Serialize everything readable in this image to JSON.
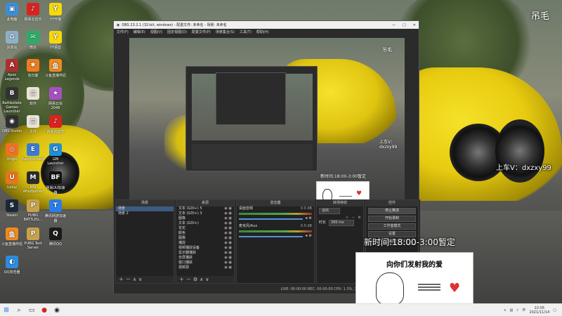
{
  "desktop": {
    "corner_text": "吊毛",
    "icons": [
      {
        "label": "此电脑",
        "icon": "computer-icon",
        "color": "#3b8edb",
        "glyph": "▣"
      },
      {
        "label": "网易云音乐",
        "icon": "netease-music-icon",
        "color": "#d8231f",
        "glyph": "♪"
      },
      {
        "label": "YY开播",
        "icon": "yy-icon",
        "color": "#f5d90a",
        "glyph": "Y"
      },
      {
        "label": "回收站",
        "icon": "recycle-bin-icon",
        "color": "#8fb0c8",
        "glyph": "♻"
      },
      {
        "label": "微信",
        "icon": "wechat-icon",
        "color": "#2aae67",
        "glyph": "✉"
      },
      {
        "label": "YY语音",
        "icon": "yy-voice-icon",
        "color": "#f5d90a",
        "glyph": "Y"
      },
      {
        "label": "Apex Legends",
        "icon": "apex-icon",
        "color": "#b22d2d",
        "glyph": "A"
      },
      {
        "label": "向日葵",
        "icon": "sunlogin-icon",
        "color": "#f07a1d",
        "glyph": "✱"
      },
      {
        "label": "斗鱼直播伴侣",
        "icon": "douyu-icon",
        "color": "#f28a1e",
        "glyph": "鱼"
      },
      {
        "label": "Battlestate Games Launcher",
        "icon": "bsg-icon",
        "color": "#333333",
        "glyph": "B"
      },
      {
        "label": "软件",
        "icon": "folder-icon",
        "color": "#e9e4d7",
        "glyph": "▤"
      },
      {
        "label": "网易云信 2048",
        "icon": "game-icon",
        "color": "#a94fc2",
        "glyph": "★"
      },
      {
        "label": "OBS Studio",
        "icon": "obs-icon",
        "color": "#302e31",
        "glyph": "◉"
      },
      {
        "label": "文件",
        "icon": "file-icon",
        "color": "#e9e4d7",
        "glyph": "▤"
      },
      {
        "label": "网易云音乐",
        "icon": "netease-music-icon-2",
        "color": "#d8231f",
        "glyph": "♪"
      },
      {
        "label": "Origin",
        "icon": "origin-icon",
        "color": "#f26f21",
        "glyph": "◎"
      },
      {
        "label": "EasyConnect",
        "icon": "easyconnect-icon",
        "color": "#3a7bd5",
        "glyph": "E"
      },
      {
        "label": "GM Launcher",
        "icon": "launcher-icon",
        "color": "#1f8fd6",
        "glyph": "G"
      },
      {
        "label": "Uplay",
        "icon": "uplay-icon",
        "color": "#e8751a",
        "glyph": "U"
      },
      {
        "label": "MSI Afterburner",
        "icon": "afterburner-icon",
        "color": "#2c2c2c",
        "glyph": "M"
      },
      {
        "label": "网易UU加速器",
        "icon": "uu-icon",
        "color": "#121212",
        "glyph": "BF"
      },
      {
        "label": "Steam",
        "icon": "steam-icon",
        "color": "#1b2838",
        "glyph": "S"
      },
      {
        "label": "PUBG BATTLEG...",
        "icon": "pubg-icon",
        "color": "#c8a24a",
        "glyph": "P"
      },
      {
        "label": "腾讯网游加速器",
        "icon": "tencent-accel-icon",
        "color": "#2b7de9",
        "glyph": "T"
      },
      {
        "label": "斗鱼直播伴侣",
        "icon": "douyu-icon-2",
        "color": "#f28a1e",
        "glyph": "鱼"
      },
      {
        "label": "PUBG Test Server",
        "icon": "pubg-test-icon",
        "color": "#c8a24a",
        "glyph": "P"
      },
      {
        "label": "腾讯QQ",
        "icon": "qq-icon",
        "color": "#1a1a1a",
        "glyph": "Q"
      },
      {
        "label": "QQ浏览器",
        "icon": "qq-browser-icon",
        "color": "#2c8ce0",
        "glyph": "◐"
      }
    ]
  },
  "obs": {
    "title": "OBS 23.2.1 (32-bit, windows) - 配置文件: 未命名 - 场景: 未命名",
    "menu": [
      "文件(F)",
      "编辑(E)",
      "视图(V)",
      "固定视图(D)",
      "配置文件(P)",
      "场景集合(S)",
      "工具(T)",
      "帮助(H)"
    ],
    "preview": {
      "corner_text": "吊毛",
      "overlay_text": "上车V：dxzxy99",
      "time_text": "新时间:18:00-3:00暂定"
    },
    "scenes": {
      "header": "场景",
      "items": [
        "场景",
        "场景 2"
      ]
    },
    "sources": {
      "header": "来源",
      "items": [
        "文本 (GDI+) 5",
        "文本 (GDI+) 3",
        "图像",
        "文本 (GDI+)",
        "花花",
        "颜色",
        "图像",
        "捕捉",
        "视频捕捉设备",
        "显示器捕获",
        "全屏捕获",
        "窗口捕获",
        "视频源"
      ]
    },
    "mixer": {
      "header": "混音器",
      "channels": [
        {
          "name": "桌面音频",
          "db": "0.0 dB"
        },
        {
          "name": "麦克风/Aux",
          "db": "0.0 dB"
        }
      ]
    },
    "transitions": {
      "header": "转场特效",
      "type": "淡出",
      "duration_label": "时长",
      "duration": "300 ms"
    },
    "controls": {
      "header": "控件",
      "buttons": [
        "停止推流",
        "开始录制",
        "工作室模式",
        "设置",
        "退出"
      ]
    },
    "status": "LIVE: 00:00:00    REC: 00:00:00    CPU: 1.3%, 30.00 fps"
  },
  "overlay": {
    "right_text": "上车V：dxzxy99",
    "time_text": "新时间:18:00-3:00暂定",
    "card_caption": "向你们发射我的爱"
  },
  "taskbar": {
    "time": "22:05",
    "date": "2021/11/14"
  }
}
